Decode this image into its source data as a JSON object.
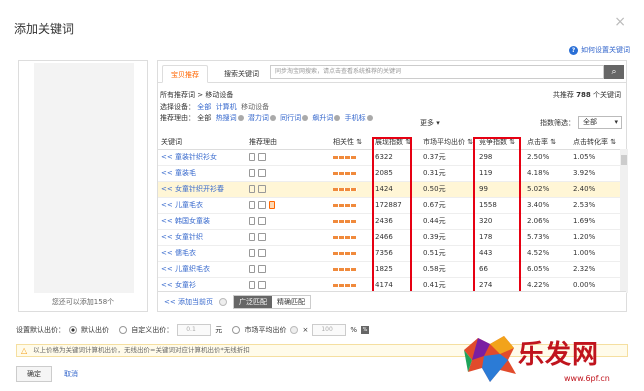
{
  "dialog": {
    "title": "添加关键词",
    "close_glyph": "×",
    "help_link": "如何设置关键词"
  },
  "left": {
    "caption": "您还可以添加158个"
  },
  "tabs": [
    {
      "label": "宝贝推荐",
      "active": true
    },
    {
      "label": "搜索关键词",
      "active": false
    }
  ],
  "search": {
    "placeholder": "同步淘宝网搜索，请点击查看系统推荐的关键词",
    "button_icon": "search-icon"
  },
  "filters": {
    "breadcrumb_prefix": "所有推荐词",
    "breadcrumb_sep": " > ",
    "breadcrumb_current": "移动设备",
    "device_label": "选择设备：",
    "device_all": "全部",
    "device_pc": "计算机",
    "device_mobile": "移动设备",
    "reason_label": "推荐理由：",
    "reason_all": "全部",
    "reasons": [
      "热搜词",
      "潜力词",
      "同行词",
      "飙升词",
      "手机标"
    ],
    "more": "更多",
    "rec_prefix": "共推荐",
    "rec_count": "788",
    "rec_suffix": "个关键词",
    "index_filter_label": "指数筛选：",
    "index_filter_value": "全部"
  },
  "table": {
    "headers": [
      "关键词",
      "推荐理由",
      "相关性",
      "展现指数",
      "市场平均出价",
      "竞争指数",
      "点击率",
      "点击转化率"
    ],
    "rows": [
      {
        "kw": "<< 童装针织衫女",
        "rel": 4,
        "imp": "6322",
        "price": "0.37元",
        "comp": "298",
        "ctr": "2.50%",
        "cvr": "1.05%",
        "hl": false,
        "icons": 2
      },
      {
        "kw": "<< 童装毛",
        "rel": 4,
        "imp": "2085",
        "price": "0.31元",
        "comp": "119",
        "ctr": "4.18%",
        "cvr": "3.92%",
        "hl": false,
        "icons": 2
      },
      {
        "kw": "<< 女童针织开衫春",
        "rel": 4,
        "imp": "1424",
        "price": "0.50元",
        "comp": "99",
        "ctr": "5.02%",
        "cvr": "2.40%",
        "hl": true,
        "icons": 2
      },
      {
        "kw": "<< 儿童毛衣",
        "rel": 4,
        "imp": "172887",
        "price": "0.67元",
        "comp": "1558",
        "ctr": "3.40%",
        "cvr": "2.53%",
        "hl": false,
        "icons": 3
      },
      {
        "kw": "<< 韩国女童装",
        "rel": 4,
        "imp": "2436",
        "price": "0.44元",
        "comp": "320",
        "ctr": "2.06%",
        "cvr": "1.69%",
        "hl": false,
        "icons": 2
      },
      {
        "kw": "<< 女童针织",
        "rel": 4,
        "imp": "2466",
        "price": "0.39元",
        "comp": "178",
        "ctr": "5.73%",
        "cvr": "1.20%",
        "hl": false,
        "icons": 2
      },
      {
        "kw": "<< 儒毛衣",
        "rel": 4,
        "imp": "7356",
        "price": "0.51元",
        "comp": "443",
        "ctr": "4.52%",
        "cvr": "1.00%",
        "hl": false,
        "icons": 2
      },
      {
        "kw": "<< 儿童织毛衣",
        "rel": 4,
        "imp": "1825",
        "price": "0.58元",
        "comp": "66",
        "ctr": "6.05%",
        "cvr": "2.32%",
        "hl": false,
        "icons": 2
      },
      {
        "kw": "<< 女童衫",
        "rel": 4,
        "imp": "4174",
        "price": "0.41元",
        "comp": "274",
        "ctr": "4.22%",
        "cvr": "0.00%",
        "hl": false,
        "icons": 2
      }
    ]
  },
  "bottom": {
    "add_page": "添加当前页",
    "match_broad": "广泛匹配",
    "match_exact": "精确匹配"
  },
  "bid": {
    "label": "设置默认出价：",
    "opt_default": "默认出价",
    "opt_custom": "自定义出价：",
    "custom_value": "0.1",
    "unit": "元",
    "opt_market": "市场平均出价",
    "times": "×",
    "pct_value": "100",
    "pct": "%"
  },
  "warning": "以上价格为关键词计算机出价，无线出价=关键词对应计算机出价*无线折扣",
  "actions": {
    "ok": "确定",
    "cancel": "取消"
  },
  "watermark": {
    "brand": "乐发网",
    "url": "www.6pf.cn"
  },
  "colors": {
    "accent": "#f60",
    "highlight": "#e60012",
    "link": "#36c"
  }
}
